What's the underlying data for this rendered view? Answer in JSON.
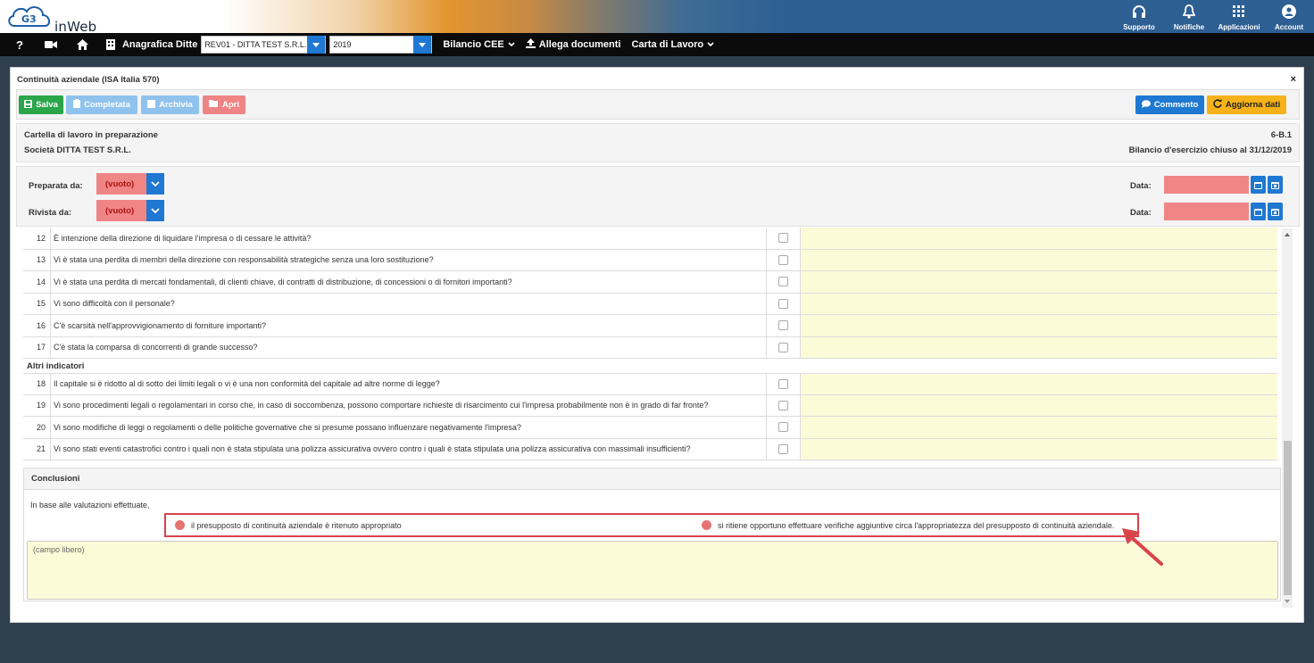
{
  "app": {
    "logo_text": "inWeb",
    "logo_mark": "G3",
    "top_actions": [
      {
        "label": "Supporto",
        "icon": "headset-icon"
      },
      {
        "label": "Notifiche",
        "icon": "bell-icon"
      },
      {
        "label": "Applicazioni",
        "icon": "grid-icon"
      },
      {
        "label": "Account",
        "icon": "user-icon"
      }
    ]
  },
  "nav": {
    "help": "?",
    "anagrafica_label": "Anagrafica Ditte",
    "company_value": "REV01 - DITTA TEST S.R.L.",
    "year_value": "2019",
    "bilancio_label": "Bilancio CEE",
    "allega_label": "Allega documenti",
    "carta_label": "Carta di Lavoro"
  },
  "panel": {
    "title": "Continuità aziendale (ISA Italia 570)",
    "close": "×",
    "buttons": {
      "salva": "Salva",
      "completata": "Completata",
      "archivia": "Archivia",
      "apri": "Apri",
      "commento": "Commento",
      "aggiorna": "Aggiorna dati"
    },
    "info": {
      "status": "Cartella di lavoro in preparazione",
      "company": "Società DITTA TEST S.R.L.",
      "code": "6-B.1",
      "bilancio": "Bilancio d'esercizio chiuso al 31/12/2019"
    },
    "signoff": {
      "prepared_label": "Preparata da:",
      "prepared_value": "(vuoto)",
      "reviewed_label": "Rivista da:",
      "reviewed_value": "(vuoto)",
      "date_label": "Data:"
    }
  },
  "questions_a": [
    {
      "num": "12",
      "text": "È intenzione della direzione di liquidare l'impresa o di cessare le attività?"
    },
    {
      "num": "13",
      "text": "Vi è stata una perdita di membri della direzione con responsabilità strategiche senza una loro sostituzione?"
    },
    {
      "num": "14",
      "text": "Vi è stata una perdita di mercati fondamentali, di clienti chiave, di contratti di distribuzione, di concessioni o di fornitori importanti?"
    },
    {
      "num": "15",
      "text": "Vi sono difficoltà con il personale?"
    },
    {
      "num": "16",
      "text": "C'è scarsità nell'approvvigionamento di forniture importanti?"
    },
    {
      "num": "17",
      "text": "C'è stata la comparsa di concorrenti di grande successo?"
    }
  ],
  "section_other": "Altri indicatori",
  "questions_b": [
    {
      "num": "18",
      "text": "Il capitale si è ridotto al di sotto dei limiti legali o vi è una non conformità del capitale ad altre norme di legge?"
    },
    {
      "num": "19",
      "text": "Vi sono procedimenti legali o regolamentari in corso che, in caso di soccombenza, possono comportare richieste di risarcimento cui l'impresa probabilmente non è in grado di far fronte?"
    },
    {
      "num": "20",
      "text": "Vi sono modifiche di leggi o regolamenti o delle politiche governative che si presume possano influenzare negativamente l'impresa?"
    },
    {
      "num": "21",
      "text": "Vi sono stati eventi catastrofici contro i quali non è stata stipulata una polizza assicurativa ovvero contro i quali è stata stipulata una polizza assicurativa con massimali insufficienti?"
    }
  ],
  "conclusions": {
    "header": "Conclusioni",
    "intro": "In base alle valutazioni effettuate,",
    "option1": "il presupposto di continuità aziendale è ritenuto appropriato",
    "option2": "si ritiene opportuno effettuare verifiche aggiuntive circa l'appropriatezza del presupposto di continuità aziendale.",
    "free_placeholder": "(campo libero)"
  },
  "colors": {
    "primary": "#1f78d1",
    "success": "#2aa54a",
    "warning": "#f6b21a",
    "danger": "#ee8484",
    "note_bg": "#fcfbd8",
    "annotation": "#d9434a"
  }
}
